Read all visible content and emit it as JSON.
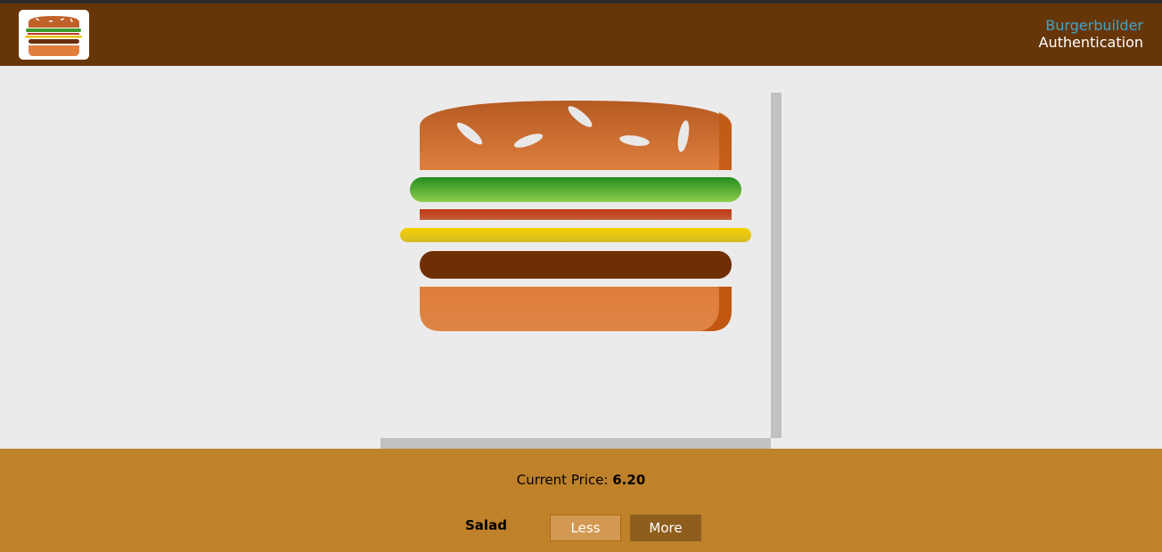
{
  "toolbar": {
    "logo_icon": "burger-logo-icon",
    "nav_items": [
      {
        "label": "Burgerbuilder",
        "active": true
      },
      {
        "label": "Authentication",
        "active": false
      }
    ]
  },
  "burger": {
    "layers": [
      "bread-top",
      "salad",
      "bacon",
      "cheese",
      "meat",
      "bread-bottom"
    ]
  },
  "build_controls": {
    "price_label": "Current Price:",
    "price_value": "6.20",
    "controls": [
      {
        "label": "Salad",
        "less_label": "Less",
        "more_label": "More"
      }
    ]
  },
  "colors": {
    "toolbar": "#663608",
    "controls_bg": "#bf822a",
    "nav_active": "#40a4c8",
    "less_button": "#d39952",
    "more_button": "#8f5e1e"
  }
}
